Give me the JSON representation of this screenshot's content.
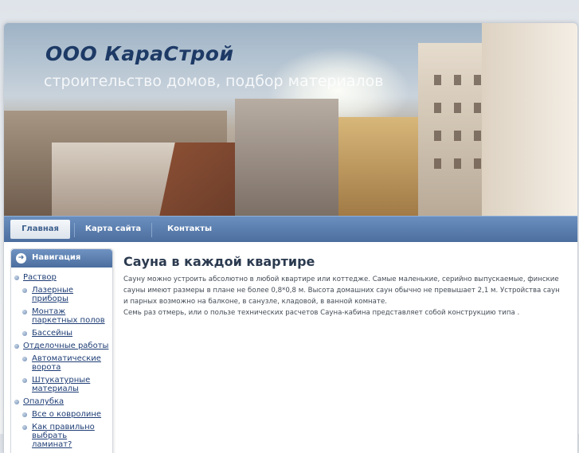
{
  "header": {
    "title": "ООО КараСтрой",
    "slogan": "строительство домов, подбор материалов"
  },
  "nav": {
    "items": [
      {
        "label": "Главная",
        "active": true
      },
      {
        "label": "Карта сайта",
        "active": false
      },
      {
        "label": "Контакты",
        "active": false
      }
    ]
  },
  "sidebar": {
    "title": "Навигация",
    "icon": "arrow-right-icon",
    "menu": [
      {
        "label": "Раствор",
        "level": 1
      },
      {
        "label": "Лазерные приборы",
        "level": 2
      },
      {
        "label": "Монтаж паркетных полов",
        "level": 2
      },
      {
        "label": "Бассейны",
        "level": 2
      },
      {
        "label": "Отделочные работы",
        "level": 1
      },
      {
        "label": "Автоматические ворота",
        "level": 2
      },
      {
        "label": "Штукатурные материалы",
        "level": 2
      },
      {
        "label": "Опалубка",
        "level": 1
      },
      {
        "label": "Все о ковролине",
        "level": 2
      },
      {
        "label": "Как правильно выбрать ламинат?",
        "level": 2
      }
    ]
  },
  "content": {
    "title": "Сауна в каждой квартире",
    "paragraph1": "Сауну можно устроить абсолютно в любой квартире или коттедже. Самые маленькие, серийно выпускаемые, финские сауны имеют размеры в плане не более 0,8*0,8 м. Высота домашних саун обычно не превышает 2,1 м. Устройства саун и парных возможно на балконе, в санузле, кладовой, в ванной комнате.",
    "paragraph2": "Семь раз отмерь, или о пользе технических расчетов Сауна-кабина представляет собой конструкцию типа ."
  },
  "colors": {
    "accent": "#4c6f9f",
    "title": "#1d3a66",
    "link": "#1e3d75"
  }
}
